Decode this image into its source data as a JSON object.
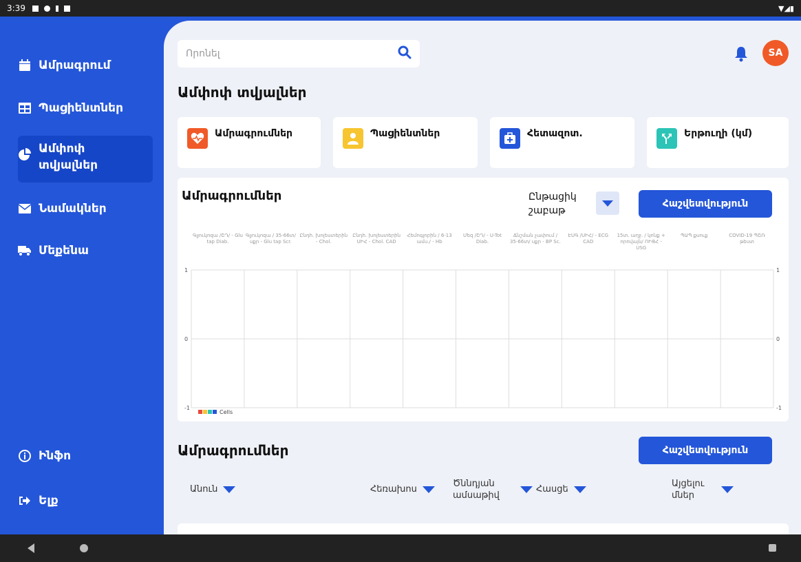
{
  "status_bar": {
    "time": "3:39"
  },
  "sidebar": {
    "items": [
      {
        "label": "Ամրագրում"
      },
      {
        "label": "Պացիենտներ"
      },
      {
        "label": "Ամփոփ տվյալներ"
      },
      {
        "label": "Նամակներ"
      },
      {
        "label": "Մեքենա"
      }
    ],
    "footer": [
      {
        "label": "Ինֆո"
      },
      {
        "label": "Ելք"
      }
    ]
  },
  "header": {
    "search_placeholder": "Որոնել",
    "avatar_initials": "SA"
  },
  "page_title": "Ամփոփ տվյալներ",
  "cards": [
    {
      "label": "Ամրագրումներ",
      "color": "#f05a28"
    },
    {
      "label": "Պացիենտներ",
      "color": "#f7c531"
    },
    {
      "label": "Հետազոտ.",
      "color": "#2456d9"
    },
    {
      "label": "Երթուղի (կմ)",
      "color": "#2bc4b6"
    }
  ],
  "chart_section": {
    "title": "Ամրագրումներ",
    "period": "Ընթացիկ շաբաթ",
    "report_button": "Հաշվետվություն"
  },
  "chart_data": {
    "type": "bar",
    "categories": [
      "Գլյուկոզա /ՇԴ/ - Glu tap Diab.",
      "Գլյուկոզա / 35-66տ/ սքր - Glu tap Scr.",
      "Ընդհ. խոլեստերին - Chol.",
      "Ընդհ. խոլեստերին ՍԻՀ - Chol. CAD",
      "Հեմոգլոբին / 6-13 ամս./ - Hb",
      "Մեզ /ՇԴ/ - U-Tot Diab.",
      "Ճնշման չափում / 35-66տ/ սքր - BP Sc.",
      "ԷՍԳ /ՍԻՀ/ - ECG CAD",
      "15տ. աղջ. / կոնք + որովայն/ ՈԻՑՀ - USG",
      "ՊԱՊ քսուք",
      "COVID-19 ՊՇՌ թեստ"
    ],
    "values": [
      0,
      0,
      0,
      0,
      0,
      0,
      0,
      0,
      0,
      0,
      0
    ],
    "ylim": [
      -1,
      1
    ],
    "yticks": [
      "1",
      "0",
      "-1"
    ],
    "legend": "Cells",
    "legend_colors": [
      "#e84a3c",
      "#f7c531",
      "#2bc4b6",
      "#2456d9"
    ]
  },
  "table_section": {
    "title": "Ամրագրումներ",
    "report_button": "Հաշվետվություն",
    "columns": [
      {
        "label": "Անուն"
      },
      {
        "label": "Հեռախոս"
      },
      {
        "label": "Ծննդյան ամսաթիվ"
      },
      {
        "label": "Հասցե"
      },
      {
        "label": "Այցելու մներ"
      }
    ]
  }
}
